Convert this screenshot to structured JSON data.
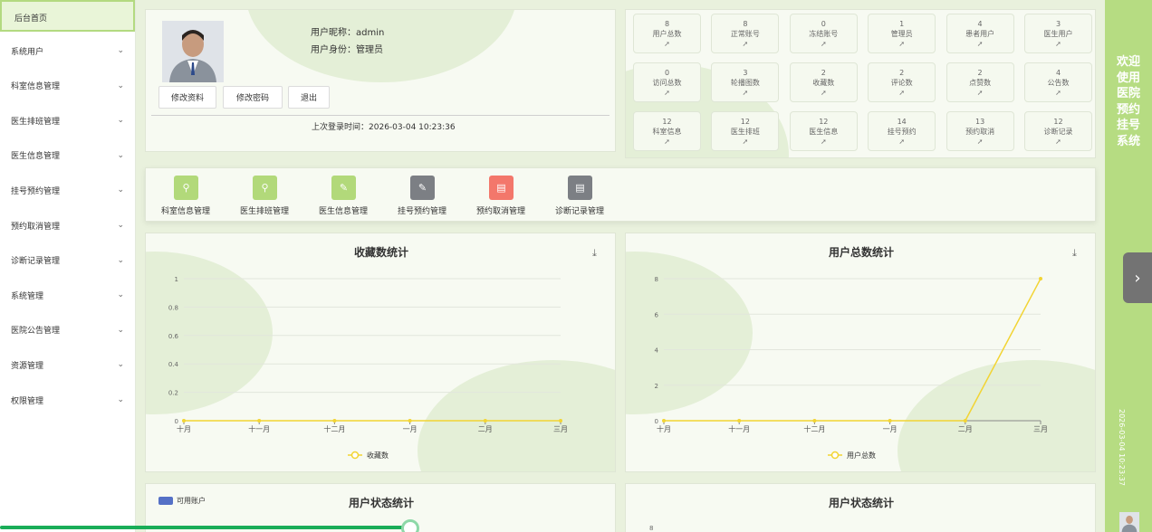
{
  "sidebar": {
    "home": "后台首页",
    "items": [
      "系统用户",
      "科室信息管理",
      "医生排班管理",
      "医生信息管理",
      "挂号预约管理",
      "预约取消管理",
      "诊断记录管理",
      "系统管理",
      "医院公告管理",
      "资源管理",
      "权限管理"
    ]
  },
  "profile": {
    "nickname_label": "用户昵称：",
    "nickname": "admin",
    "role_label": "用户身份：",
    "role": "管理员",
    "buttons": {
      "edit": "修改资料",
      "password": "修改密码",
      "logout": "退出"
    },
    "last_login_label": "上次登录时间：",
    "last_login": "2026-03-04 10:23:36"
  },
  "stats": [
    {
      "value": "8",
      "label": "用户总数"
    },
    {
      "value": "8",
      "label": "正常账号"
    },
    {
      "value": "0",
      "label": "冻结账号"
    },
    {
      "value": "1",
      "label": "管理员"
    },
    {
      "value": "4",
      "label": "患者用户"
    },
    {
      "value": "3",
      "label": "医生用户"
    },
    {
      "value": "0",
      "label": "访问总数"
    },
    {
      "value": "3",
      "label": "轮播图数"
    },
    {
      "value": "2",
      "label": "收藏数"
    },
    {
      "value": "2",
      "label": "评论数"
    },
    {
      "value": "2",
      "label": "点赞数"
    },
    {
      "value": "4",
      "label": "公告数"
    },
    {
      "value": "12",
      "label": "科室信息"
    },
    {
      "value": "12",
      "label": "医生排班"
    },
    {
      "value": "12",
      "label": "医生信息"
    },
    {
      "value": "14",
      "label": "挂号预约"
    },
    {
      "value": "13",
      "label": "预约取消"
    },
    {
      "value": "12",
      "label": "诊断记录"
    }
  ],
  "stat_icon": "send-arrow-icon",
  "quick": [
    {
      "label": "科室信息管理",
      "color": "#b2d97a",
      "icon": "search-icon"
    },
    {
      "label": "医生排班管理",
      "color": "#b2d97a",
      "icon": "search-icon"
    },
    {
      "label": "医生信息管理",
      "color": "#b2d97a",
      "icon": "edit-icon"
    },
    {
      "label": "挂号预约管理",
      "color": "#7c7f84",
      "icon": "edit-icon"
    },
    {
      "label": "预约取消管理",
      "color": "#f3776b",
      "icon": "document-icon"
    },
    {
      "label": "诊断记录管理",
      "color": "#7c7f84",
      "icon": "document-icon"
    }
  ],
  "chart_data": [
    {
      "type": "line",
      "title": "收藏数统计",
      "categories": [
        "十月",
        "十一月",
        "十二月",
        "一月",
        "二月",
        "三月"
      ],
      "series": [
        {
          "name": "收藏数",
          "values": [
            0,
            0,
            0,
            0,
            0,
            0
          ]
        }
      ],
      "ylim": [
        0,
        1
      ],
      "yticks": [
        "0",
        "0.2",
        "0.4",
        "0.6",
        "0.8",
        "1"
      ],
      "color": "#f2d433"
    },
    {
      "type": "line",
      "title": "用户总数统计",
      "categories": [
        "十月",
        "十一月",
        "十二月",
        "一月",
        "二月",
        "三月"
      ],
      "series": [
        {
          "name": "用户总数",
          "values": [
            0,
            0,
            0,
            0,
            0,
            8
          ]
        }
      ],
      "ylim": [
        0,
        8
      ],
      "yticks": [
        "0",
        "2",
        "4",
        "6",
        "8"
      ],
      "color": "#f2d433"
    }
  ],
  "bottom": {
    "left_title": "用户状态统计",
    "legend": "可用账户",
    "legend_color": "#5470c6",
    "right_title": "用户状态统计",
    "right_tick": "8"
  },
  "rightbar": {
    "title": "欢迎使用医院预约挂号系统",
    "date": "2026-03-04 10:23:37"
  }
}
